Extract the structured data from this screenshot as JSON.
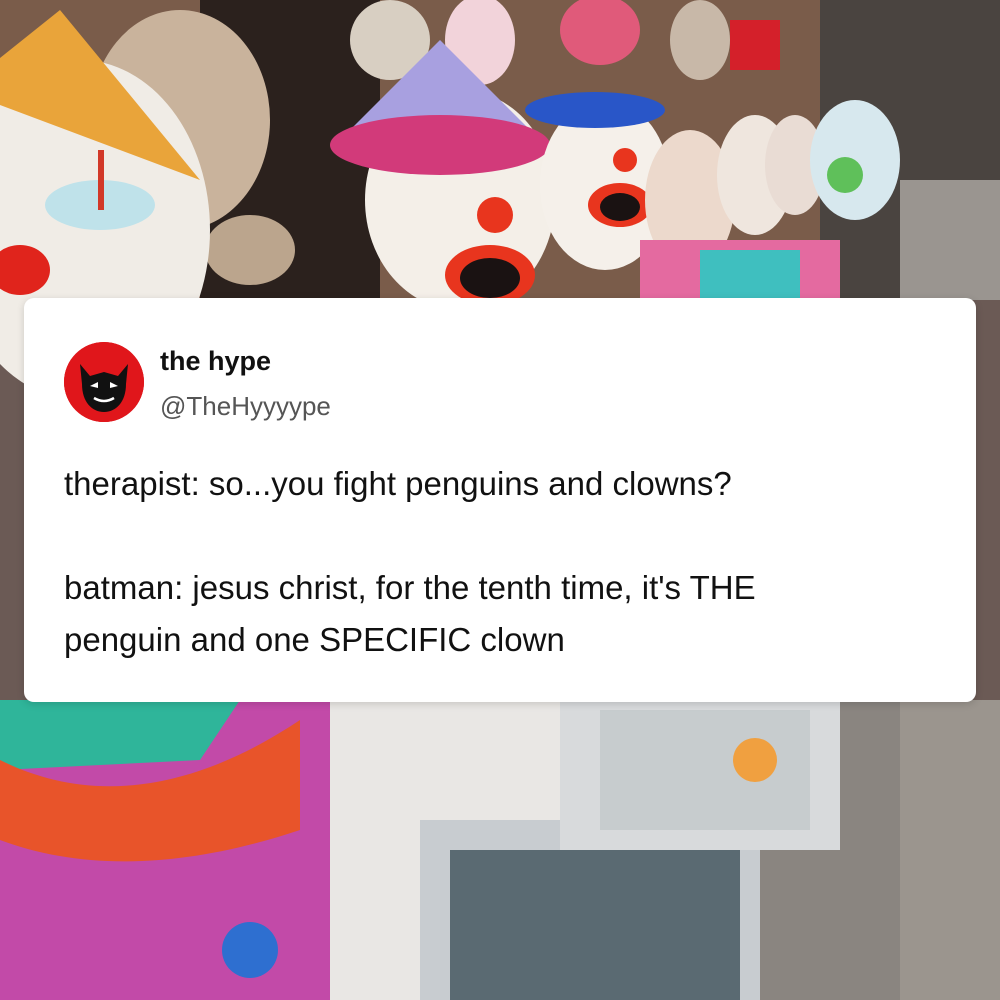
{
  "post": {
    "display_name": "the hype",
    "handle": "@TheHyyyype",
    "avatar_icon": "devil-face-icon",
    "lines": [
      "therapist: so...you fight penguins and clowns?",
      "batman: jesus christ, for the tenth time, it's THE",
      "penguin and one SPECIFIC clown"
    ]
  },
  "colors": {
    "avatar_bg": "#e0161b",
    "card_bg": "#ffffff",
    "text": "#111111",
    "handle": "#555555"
  }
}
